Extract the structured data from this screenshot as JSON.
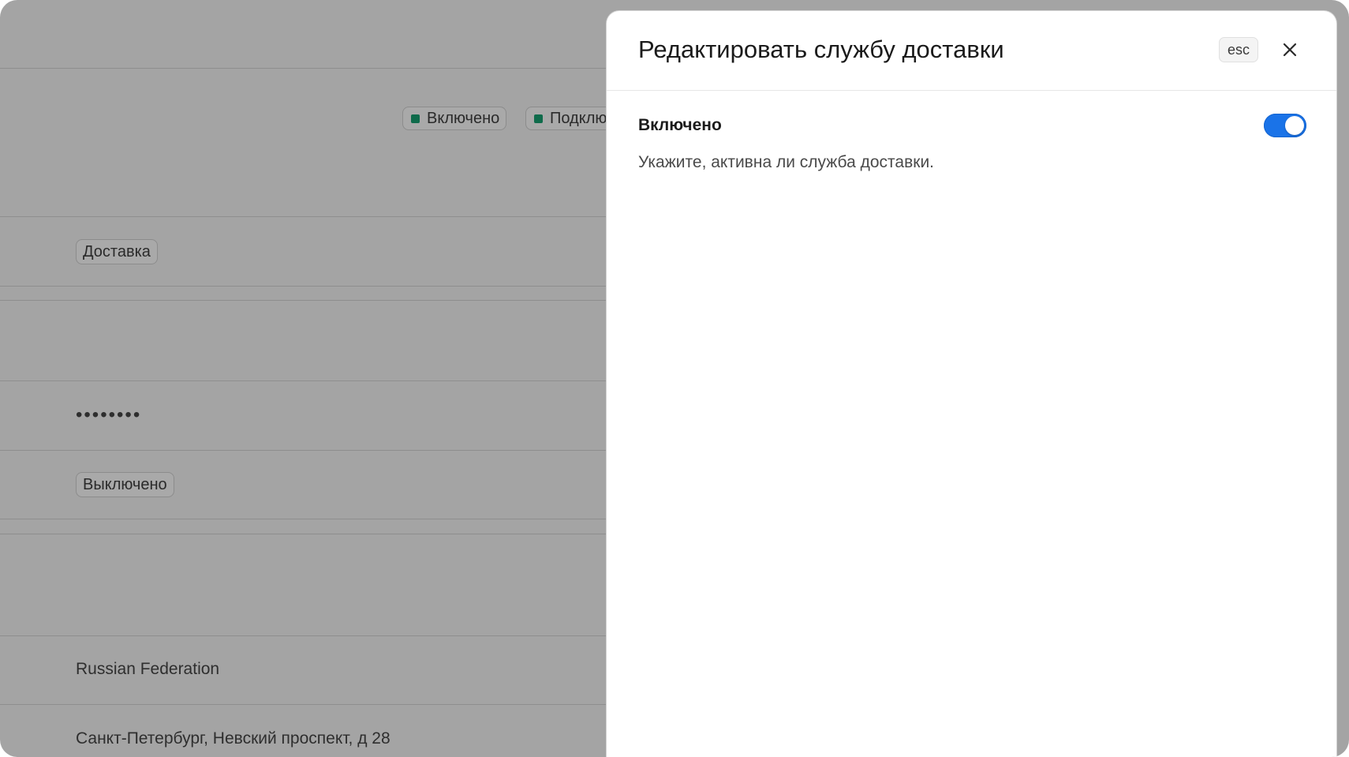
{
  "background": {
    "status_badges": [
      {
        "label": "Включено",
        "color": "#0f6b4b"
      },
      {
        "label": "Подклю",
        "color": "#0f6b4b"
      }
    ],
    "rows": {
      "type_tag": "Доставка",
      "password_mask": "••••••••",
      "mode_tag": "Выключено",
      "country": "Russian Federation",
      "address": "Санкт-Петербург, Невский проспект, д 28"
    }
  },
  "drawer": {
    "title": "Редактировать службу доставки",
    "esc_hint": "esc",
    "close_icon": "close-icon",
    "enabled_field": {
      "label": "Включено",
      "hint": "Укажите, активна ли служба доставки.",
      "value": true,
      "accent_color": "#1a73e8"
    }
  }
}
